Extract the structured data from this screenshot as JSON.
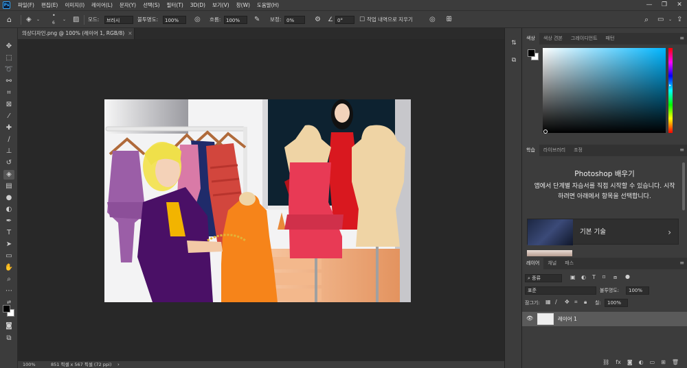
{
  "app": {
    "logo": "Ps"
  },
  "menu": [
    "파일(F)",
    "편집(E)",
    "이미지(I)",
    "레이어(L)",
    "문자(Y)",
    "선택(S)",
    "필터(T)",
    "3D(D)",
    "보기(V)",
    "창(W)",
    "도움말(H)"
  ],
  "window_controls": {
    "minimize": "—",
    "restore": "❐",
    "close": "✕"
  },
  "options": {
    "brush_size": "6",
    "mode_label": "모드:",
    "mode_value": "브러시",
    "opacity_label": "불투명도:",
    "opacity_value": "100%",
    "flow_label": "흐름:",
    "flow_value": "100%",
    "smoothing_label": "보정:",
    "smoothing_value": "0%",
    "angle_value": "0°",
    "erase_history_label": "작업 내역으로 지우기"
  },
  "document": {
    "tab_title": "의상디자인.png @ 100% (레이어 1, RGB/8)",
    "close": "×"
  },
  "status": {
    "zoom": "100%",
    "doc_info": "851 픽셀 x 567 픽셀 (72 ppi)"
  },
  "color_panel": {
    "tabs": [
      "색상",
      "색상 견본",
      "그레이디언트",
      "패턴"
    ],
    "active_tab": "색상",
    "foreground": "#000000",
    "background": "#ffffff",
    "picker_hue": "#00b6ff"
  },
  "learn_panel": {
    "tabs": [
      "학습",
      "라이브러리",
      "조정"
    ],
    "active_tab": "학습",
    "title": "Photoshop 배우기",
    "description": "앱에서 단계별 자습서를 직접 시작할 수 있습니다. 시작하려면 아래에서 항목을 선택합니다.",
    "card_label": "기본 기술"
  },
  "layers_panel": {
    "tabs": [
      "레이어",
      "채널",
      "패스"
    ],
    "active_tab": "레이어",
    "filter_label": "종류",
    "blend_mode": "표준",
    "opacity_label": "불투명도:",
    "opacity_value": "100%",
    "lock_label": "잠그기:",
    "fill_label": "칠:",
    "fill_value": "100%",
    "layers": [
      {
        "name": "레이어 1",
        "visible": true
      }
    ],
    "footer_icons": [
      "link-icon",
      "fx-icon",
      "mask-icon",
      "adjustment-icon",
      "group-icon",
      "new-layer-icon",
      "trash-icon"
    ]
  }
}
